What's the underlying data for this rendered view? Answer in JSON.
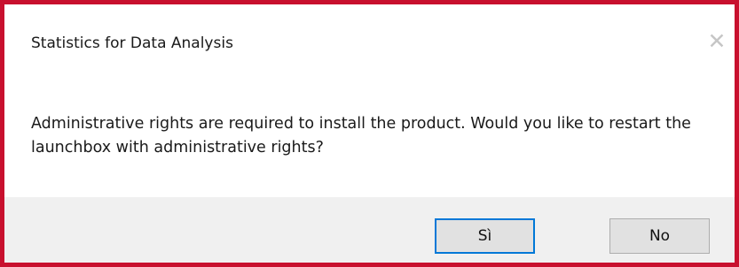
{
  "window": {
    "title": "Statistics for Data Analysis",
    "close_glyph": "✕"
  },
  "message": {
    "text": "Administrative rights are required to install the product. Would you like to restart the launchbox with administrative rights?"
  },
  "buttons": {
    "yes_label": "Sì",
    "no_label": "No"
  },
  "colors": {
    "frame_border": "#c8102e",
    "footer_bg": "#f0f0f0",
    "focus_border": "#0078d7"
  }
}
